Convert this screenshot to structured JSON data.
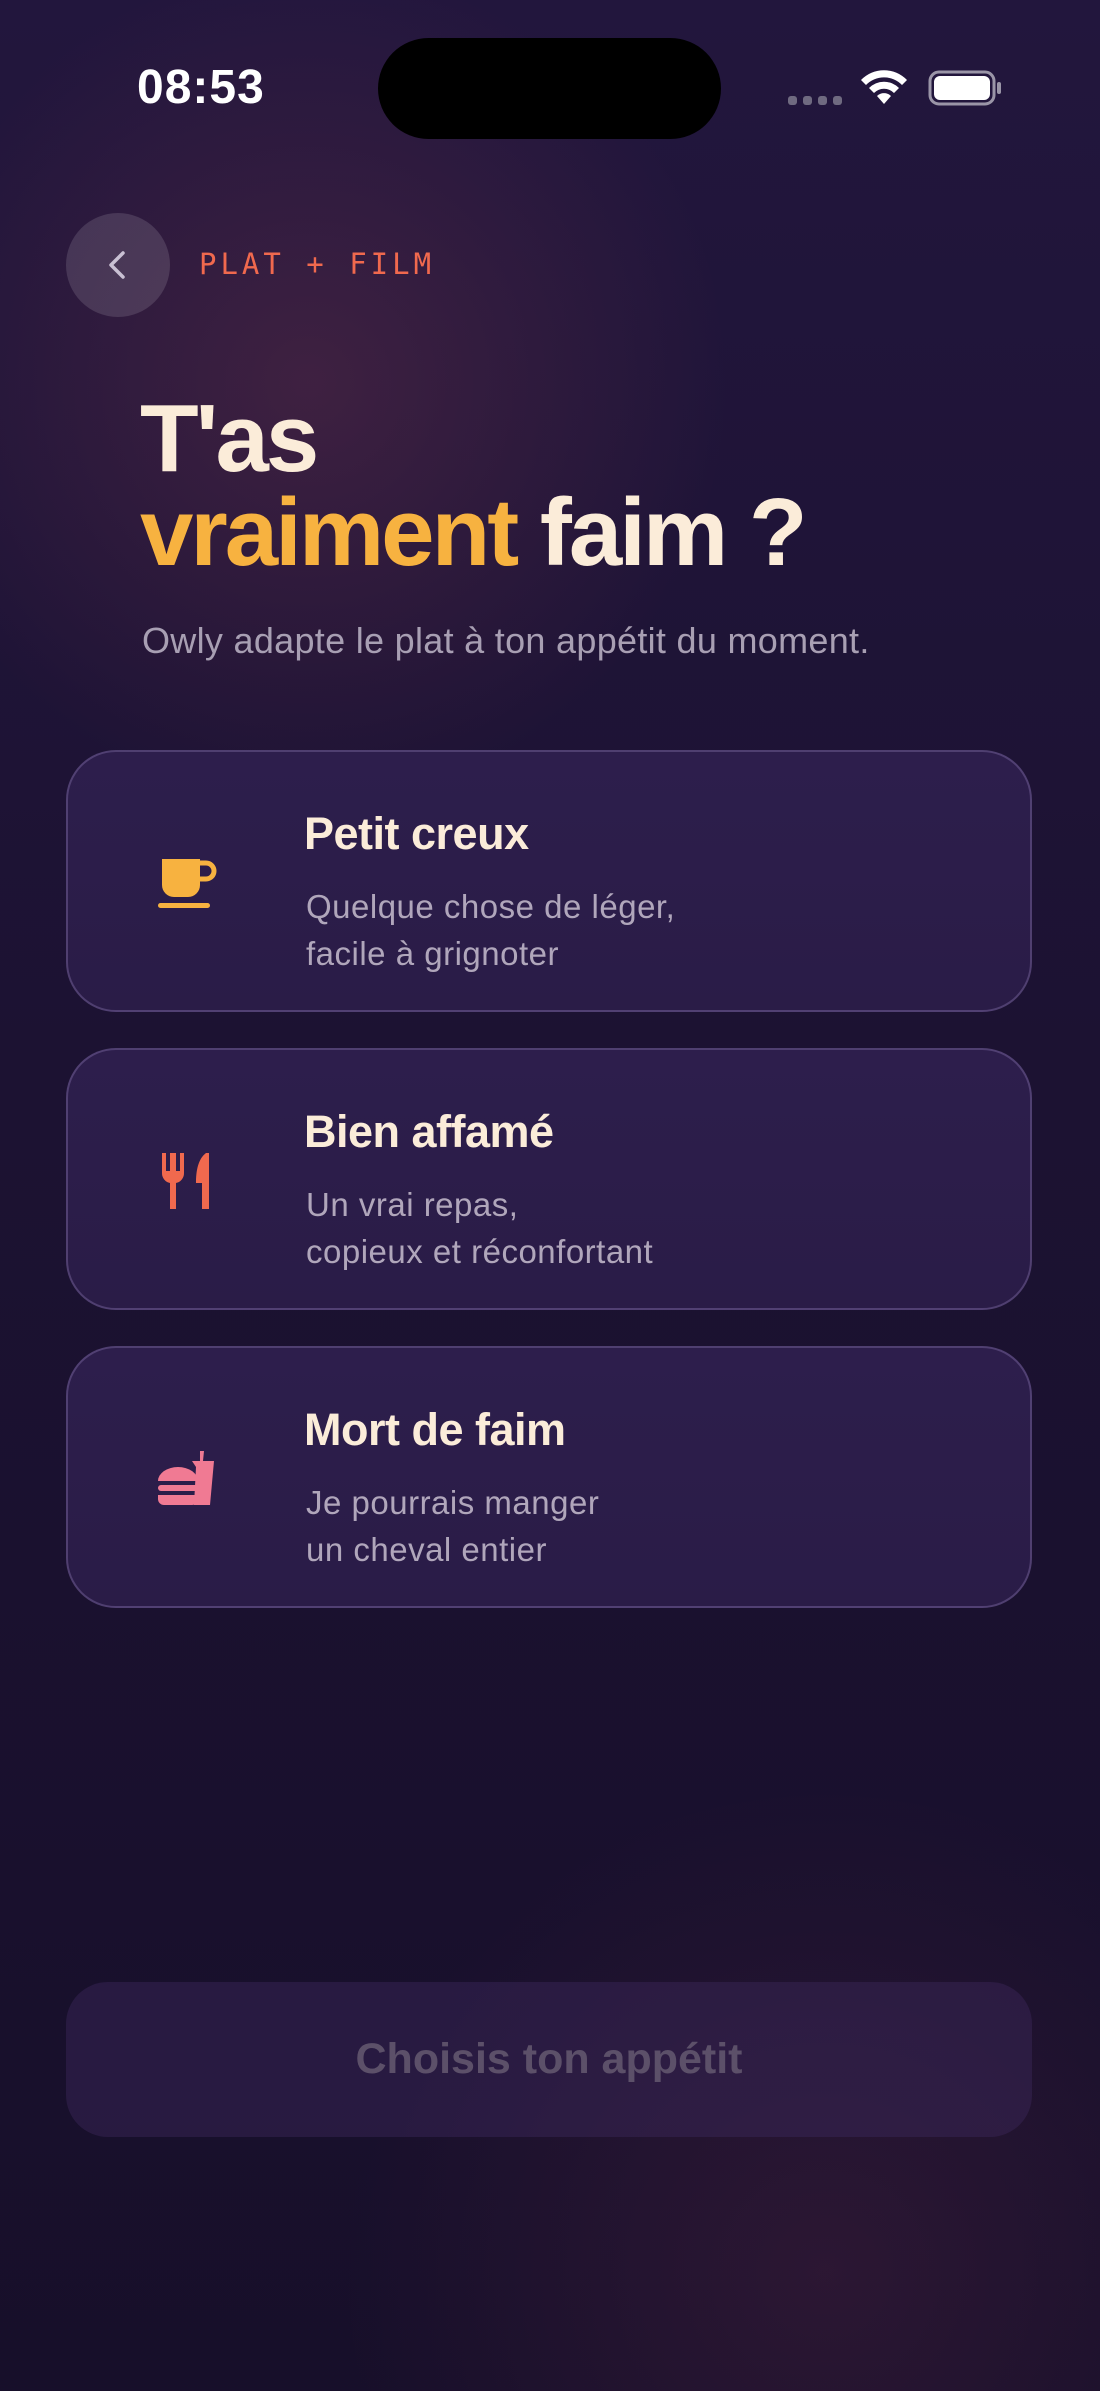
{
  "status_bar": {
    "time": "08:53",
    "icons": [
      "signal-icon",
      "wifi-icon",
      "battery-icon"
    ]
  },
  "header": {
    "back_icon": "chevron-left-icon",
    "breadcrumb": "PLAT + FILM"
  },
  "title": {
    "line1": "T'as",
    "accent": "vraiment",
    "rest": " faim ?"
  },
  "subtitle": "Owly adapte le plat à ton appétit du moment.",
  "options": [
    {
      "icon": "coffee-cup-icon",
      "icon_color": "#f7b240",
      "title": "Petit creux",
      "description": "Quelque chose de léger,\nfacile à grignoter"
    },
    {
      "icon": "fork-knife-icon",
      "icon_color": "#f0694e",
      "title": "Bien affamé",
      "description": "Un vrai repas,\ncopieux et réconfortant"
    },
    {
      "icon": "burger-drink-icon",
      "icon_color": "#f07a93",
      "title": "Mort de faim",
      "description": "Je pourrais manger\nun cheval entier"
    }
  ],
  "cta": {
    "label": "Choisis ton appétit"
  },
  "colors": {
    "accent_yellow": "#f7b240",
    "accent_orange": "#f0694e",
    "accent_pink": "#f07a93",
    "background": "#1c1232",
    "card": "#2c1e4a"
  }
}
